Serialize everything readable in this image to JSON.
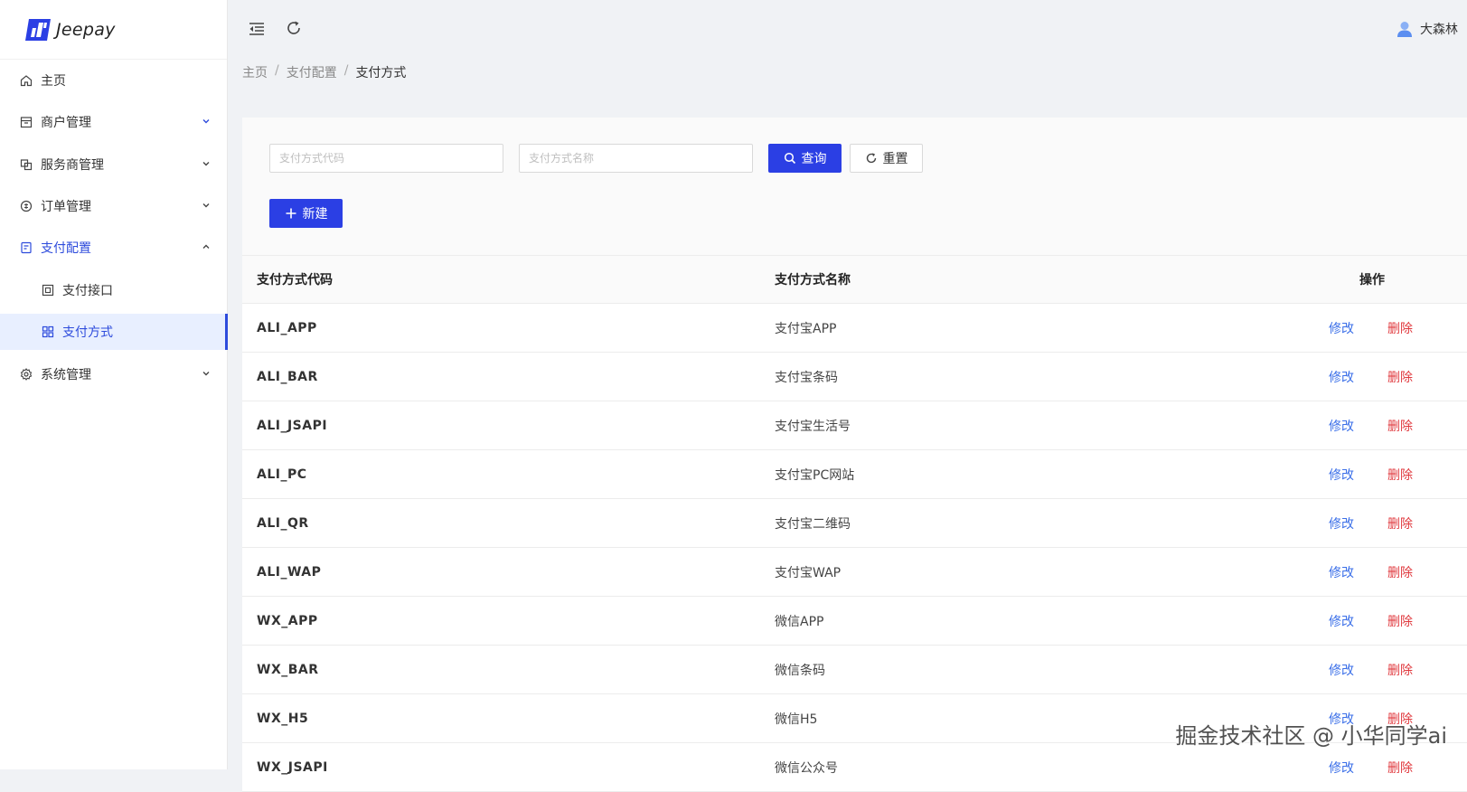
{
  "app": {
    "logo_text": "Jeepay"
  },
  "sidebar": {
    "items": [
      {
        "label": "主页",
        "icon": "home-icon"
      },
      {
        "label": "商户管理",
        "icon": "shop-icon"
      },
      {
        "label": "服务商管理",
        "icon": "partner-icon"
      },
      {
        "label": "订单管理",
        "icon": "order-icon"
      },
      {
        "label": "支付配置",
        "icon": "payment-config-icon"
      },
      {
        "label": "支付接口",
        "icon": "interface-icon"
      },
      {
        "label": "支付方式",
        "icon": "grid-icon"
      },
      {
        "label": "系统管理",
        "icon": "settings-icon"
      }
    ]
  },
  "header": {
    "username": "大森林"
  },
  "breadcrumb": [
    "主页",
    "支付配置",
    "支付方式"
  ],
  "filters": {
    "code_placeholder": "支付方式代码",
    "name_placeholder": "支付方式名称",
    "query_label": "查询",
    "reset_label": "重置",
    "new_label": "新建"
  },
  "table": {
    "headers": [
      "支付方式代码",
      "支付方式名称",
      "操作"
    ],
    "edit_label": "修改",
    "delete_label": "删除",
    "rows": [
      {
        "code": "ALI_APP",
        "name": "支付宝APP"
      },
      {
        "code": "ALI_BAR",
        "name": "支付宝条码"
      },
      {
        "code": "ALI_JSAPI",
        "name": "支付宝生活号"
      },
      {
        "code": "ALI_PC",
        "name": "支付宝PC网站"
      },
      {
        "code": "ALI_QR",
        "name": "支付宝二维码"
      },
      {
        "code": "ALI_WAP",
        "name": "支付宝WAP"
      },
      {
        "code": "WX_APP",
        "name": "微信APP"
      },
      {
        "code": "WX_BAR",
        "name": "微信条码"
      },
      {
        "code": "WX_H5",
        "name": "微信H5"
      },
      {
        "code": "WX_JSAPI",
        "name": "微信公众号"
      }
    ]
  },
  "watermark": "掘金技术社区 @ 小华同学ai",
  "colors": {
    "primary": "#2b3fe4",
    "edit_link": "#3b6fe8",
    "delete_link": "#e0393e",
    "selected_bg": "#e8efff"
  }
}
